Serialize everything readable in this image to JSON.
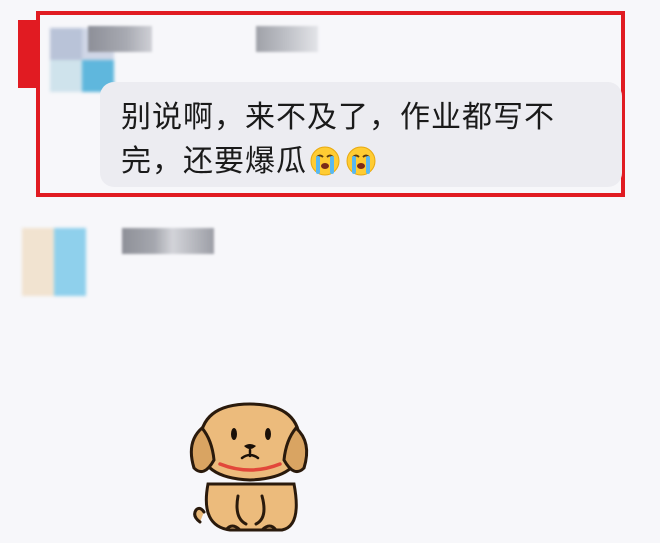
{
  "message": {
    "text": "别说啊，来不及了，作业都写不完，还要爆瓜",
    "emojis": [
      "loudly-crying-face-icon",
      "loudly-crying-face-icon"
    ]
  },
  "colors": {
    "highlight": "#e11b22",
    "bubble": "#ececf1",
    "background": "#f7f7fa"
  },
  "sticker": {
    "icon": "puppy-sticker-icon"
  }
}
